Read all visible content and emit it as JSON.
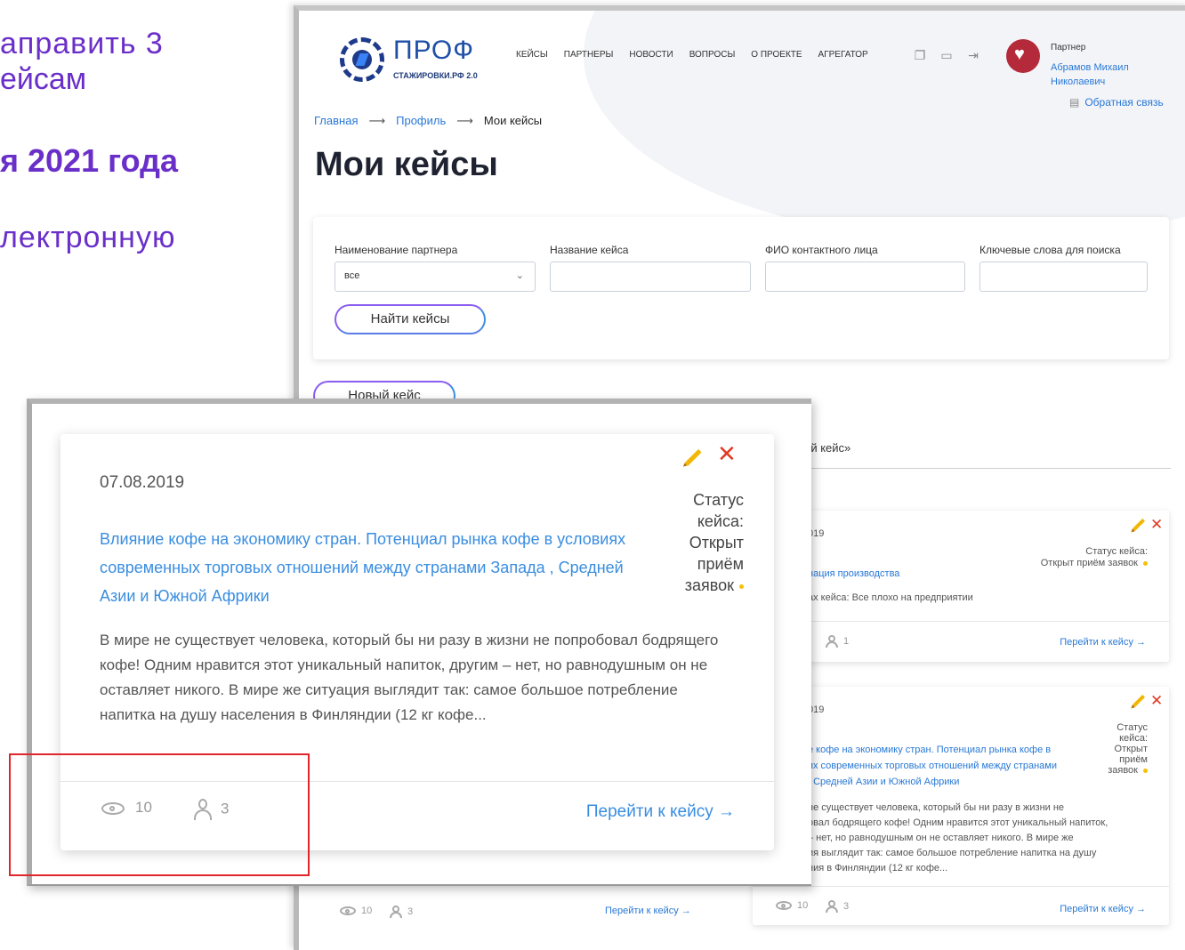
{
  "slide": {
    "line1": "аправить  3",
    "line2": "ейсам",
    "line3": "я 2021 года",
    "line4": "лектронную"
  },
  "header": {
    "logo_title": "ПРОФ",
    "logo_subtitle": "СТАЖИРОВКИ.РФ 2.0",
    "nav": [
      "КЕЙСЫ",
      "ПАРТНЕРЫ",
      "НОВОСТИ",
      "ВОПРОСЫ",
      "О ПРОЕКТЕ",
      "АГРЕГАТОР"
    ],
    "icons": [
      "documents-icon",
      "chat-icon",
      "logout-icon"
    ],
    "user_role": "Партнер",
    "user_name": "Абрамов Михаил Николаевич",
    "feedback": "Обратная связь"
  },
  "breadcrumb": [
    "Главная",
    "Профиль",
    "Мои кейсы"
  ],
  "page_title": "Мои кейсы",
  "filters": {
    "partner_label": "Наименование партнера",
    "partner_value": "все",
    "case_label": "Название кейса",
    "contact_label": "ФИО контактного лица",
    "keywords_label": "Ключевые слова для поиска",
    "search_button": "Найти кейсы"
  },
  "new_case_button": "Новый кейс",
  "tab_fragment": "ый кейс»",
  "card_small_1": {
    "date_fragment": "019",
    "status": "Статус кейса:",
    "status_value": "Открыт приём заявок",
    "title_fragment": "нация производства",
    "desc_fragment": "ах кейса: Все плохо на предприятии",
    "responses": "1",
    "go": "Перейти к кейсу →"
  },
  "card_small_2": {
    "date_fragment": "019",
    "status_lines": [
      "Статус",
      "кейса:",
      "Открыт",
      "приём",
      "заявок"
    ],
    "title_lines": [
      "е кофе на экономику стран. Потенциал рынка кофе в",
      "ях современных торговых отношений между странами",
      ", Средней Азии и Южной Африки"
    ],
    "desc_lines": [
      "не существует человека, который бы ни разу в жизни не",
      "овал бодрящего кофе! Одним нравится этот уникальный напиток,",
      "– нет, но равнодушным он не оставляет никого. В мире же",
      "ия выглядит так: самое большое потребление напитка на душу",
      "ния в Финляндии (12 кг кофе..."
    ],
    "views": "10",
    "responses": "3",
    "go": "Перейти к кейсу →"
  },
  "bottom_left_card": {
    "views": "10",
    "responses": "3",
    "go": "Перейти к кейсу →"
  },
  "zoom_card": {
    "date": "07.08.2019",
    "status_lines": [
      "Статус",
      "кейса:",
      "Открыт",
      "приём",
      "заявок"
    ],
    "title": "Влияние кофе на экономику стран. Потенциал рынка кофе в условиях современных торговых отношений между странами Запада , Средней Азии и Южной Африки",
    "description": "В мире не существует человека, который бы ни разу в жизни не попробовал бодрящего кофе! Одним нравится этот уникальный напиток, другим – нет, но равнодушным он не оставляет никого. В мире же ситуация выглядит так: самое большое потребление напитка на душу населения в Финляндии (12 кг кофе...",
    "views": "10",
    "responses": "3",
    "go": "Перейти к кейсу →"
  },
  "colors": {
    "accent_purple": "#6a2fc9",
    "link_blue": "#2878d6",
    "status_dot": "#f5c200",
    "delete_red": "#e23a22",
    "highlight_red": "#e0262b"
  }
}
